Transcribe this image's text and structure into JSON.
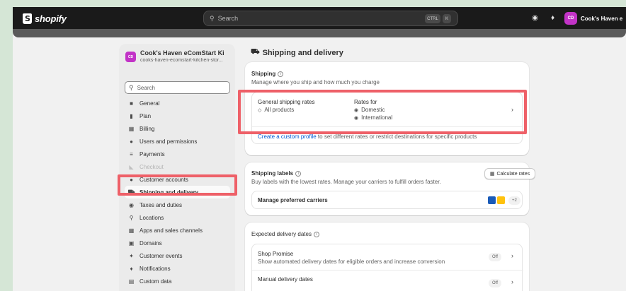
{
  "topbar": {
    "logo_text": "shopify",
    "search_placeholder": "Search",
    "shortcut_ctrl": "CTRL",
    "shortcut_key": "K",
    "store_initials": "CD",
    "store_label": "Cook's Haven e"
  },
  "sidebar": {
    "store_initials": "CD",
    "store_name": "Cook's Haven eComStart Kitch...",
    "store_url": "cooks-haven-ecomstart-kitchen-stor...",
    "search_placeholder": "Search",
    "items": [
      {
        "label": "General",
        "icon": "store-icon"
      },
      {
        "label": "Plan",
        "icon": "plan-icon"
      },
      {
        "label": "Billing",
        "icon": "billing-icon"
      },
      {
        "label": "Users and permissions",
        "icon": "users-icon"
      },
      {
        "label": "Payments",
        "icon": "payments-icon"
      },
      {
        "label": "Checkout",
        "icon": "cart-icon"
      },
      {
        "label": "Customer accounts",
        "icon": "person-icon"
      },
      {
        "label": "Shipping and delivery",
        "icon": "truck-icon"
      },
      {
        "label": "Taxes and duties",
        "icon": "tax-icon"
      },
      {
        "label": "Locations",
        "icon": "location-icon"
      },
      {
        "label": "Apps and sales channels",
        "icon": "apps-icon"
      },
      {
        "label": "Domains",
        "icon": "domains-icon"
      },
      {
        "label": "Customer events",
        "icon": "events-icon"
      },
      {
        "label": "Notifications",
        "icon": "bell-icon"
      },
      {
        "label": "Custom data",
        "icon": "data-icon"
      }
    ]
  },
  "main": {
    "title": "Shipping and delivery",
    "shipping": {
      "title": "Shipping",
      "subtitle": "Manage where you ship and how much you charge",
      "general_rates_label": "General shipping rates",
      "all_products": "All products",
      "rates_for_label": "Rates for",
      "domestic": "Domestic",
      "international": "International",
      "custom_profile_link": "Create a custom profile",
      "custom_profile_rest": " to set different rates or restrict destinations for specific products"
    },
    "labels": {
      "title": "Shipping labels",
      "subtitle": "Buy labels with the lowest rates. Manage your carriers to fulfill orders faster.",
      "calc_button": "Calculate rates",
      "manage_carriers": "Manage preferred carriers",
      "more_carriers": "+2"
    },
    "delivery": {
      "title": "Expected delivery dates",
      "shop_promise_title": "Shop Promise",
      "shop_promise_desc": "Show automated delivery dates for eligible orders and increase conversion",
      "shop_promise_status": "Off",
      "manual_title": "Manual delivery dates",
      "manual_status": "Off"
    }
  },
  "colors": {
    "highlight": "#ee6068",
    "avatar": "#c233c7",
    "link": "#005bd3"
  }
}
